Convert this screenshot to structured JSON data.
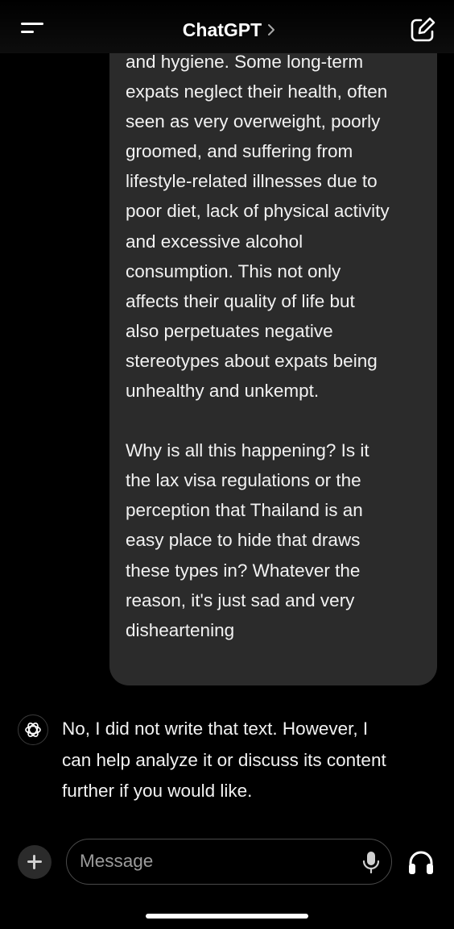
{
  "header": {
    "title": "ChatGPT",
    "menu_icon": "menu-icon",
    "chevron_icon": "chevron-right-icon",
    "new_chat_icon": "edit-icon"
  },
  "user_message": {
    "paragraphs": [
      "and hygiene. Some long-term\nexpats neglect their health, often\nseen as very overweight, poorly\ngroomed, and suffering from\nlifestyle-related illnesses due to\npoor diet, lack of physical activity\nand excessive alcohol\nconsumption. This not only\naffects their quality of life but\nalso perpetuates negative\nstereotypes about expats being\nunhealthy and unkempt.",
      "Why is all this happening? Is it\nthe lax visa regulations or the\nperception that Thailand is an\neasy place to hide that draws\nthese types in? Whatever the\nreason, it's just sad and very\ndisheartening"
    ]
  },
  "assistant_message": {
    "avatar_icon": "openai-logo-icon",
    "text": "No, I did not write that text. However, I\ncan help analyze it or discuss its content\nfurther if you would like."
  },
  "composer": {
    "placeholder": "Message",
    "plus_icon": "plus-icon",
    "mic_icon": "microphone-icon",
    "voice_icon": "headphones-icon"
  },
  "colors": {
    "background": "#000000",
    "bubble": "#2b2b2b",
    "text": "#f2f2f2",
    "placeholder": "#9b9b9b"
  }
}
